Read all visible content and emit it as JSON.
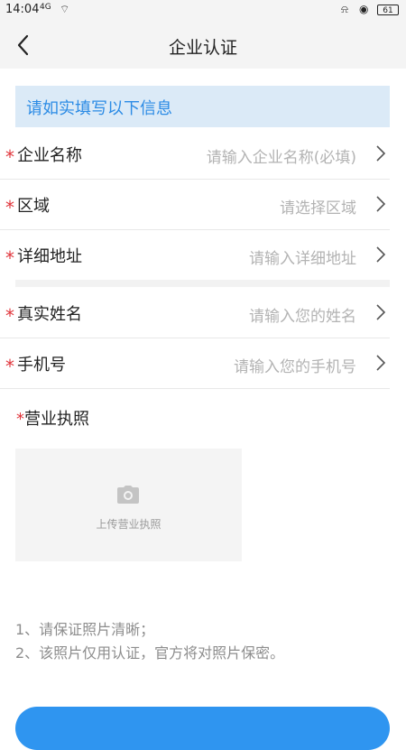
{
  "status_bar": {
    "time": "14:04",
    "signal": "4G",
    "battery": "61"
  },
  "header": {
    "title": "企业认证"
  },
  "notice": "请如实填写以下信息",
  "required_mark": "*",
  "fields": [
    {
      "label": "企业名称",
      "placeholder": "请输入企业名称(必填)"
    },
    {
      "label": "区域",
      "placeholder": "请选择区域"
    },
    {
      "label": "详细地址",
      "placeholder": "请输入详细地址"
    },
    {
      "label": "真实姓名",
      "placeholder": "请输入您的姓名"
    },
    {
      "label": "手机号",
      "placeholder": "请输入您的手机号"
    }
  ],
  "license": {
    "label": "营业执照",
    "upload_caption": "上传营业执照"
  },
  "tips": [
    "1、请保证照片清晰；",
    "2、该照片仅用认证，官方将对照片保密。"
  ],
  "colors": {
    "accent": "#2f95f0",
    "notice_bg": "#dbeaf7",
    "notice_text": "#2b8be5",
    "required": "#e0353b"
  }
}
